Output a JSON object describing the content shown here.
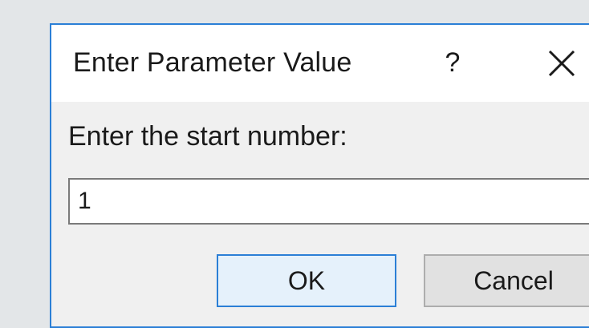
{
  "dialog": {
    "title": "Enter Parameter Value",
    "help_label": "?",
    "close_icon": "close-icon",
    "prompt": "Enter the start number:",
    "input_value": "1",
    "ok_label": "OK",
    "cancel_label": "Cancel"
  },
  "colors": {
    "accent": "#2b7fd6",
    "ok_fill": "#e5f1fb",
    "dialog_bg": "#f0f0f0",
    "titlebar_bg": "#ffffff"
  }
}
